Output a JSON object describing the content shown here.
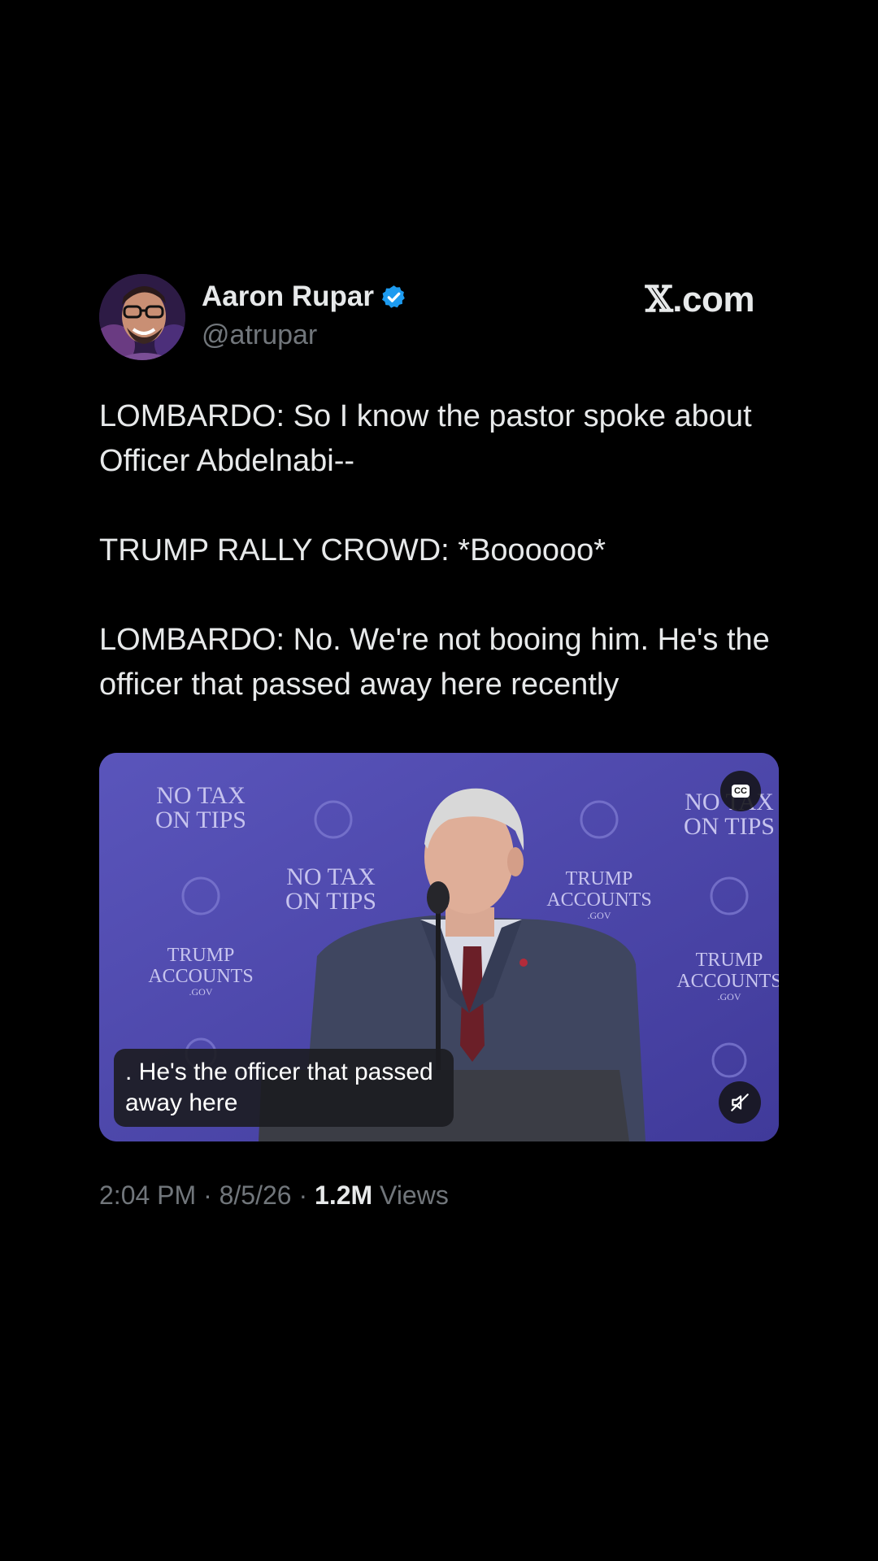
{
  "tweet": {
    "author_name": "Aaron Rupar",
    "author_handle": "@atrupar",
    "brand": ".com",
    "brand_mark": "𝕏",
    "text": [
      "LOMBARDO: So I know the pastor spoke about Officer Abdelnabi--",
      "TRUMP RALLY CROWD: *Boooooo*",
      "LOMBARDO: No. We're not booing him. He's the officer that passed away here recently"
    ],
    "video": {
      "caption": ". He's the officer that passed away here",
      "signs": {
        "no_tax": "NO TAX",
        "on_tips": "ON TIPS",
        "trump": "TRUMP",
        "accounts": "ACCOUNTS",
        "gov": ".GOV"
      },
      "cc_label": "CC",
      "background_color": "#4b45a8"
    },
    "time": "2:04 PM",
    "date": "8/5/26",
    "views_count": "1.2M",
    "views_label": "Views",
    "separator": " · ",
    "verified_color": "#1d9bf0"
  }
}
